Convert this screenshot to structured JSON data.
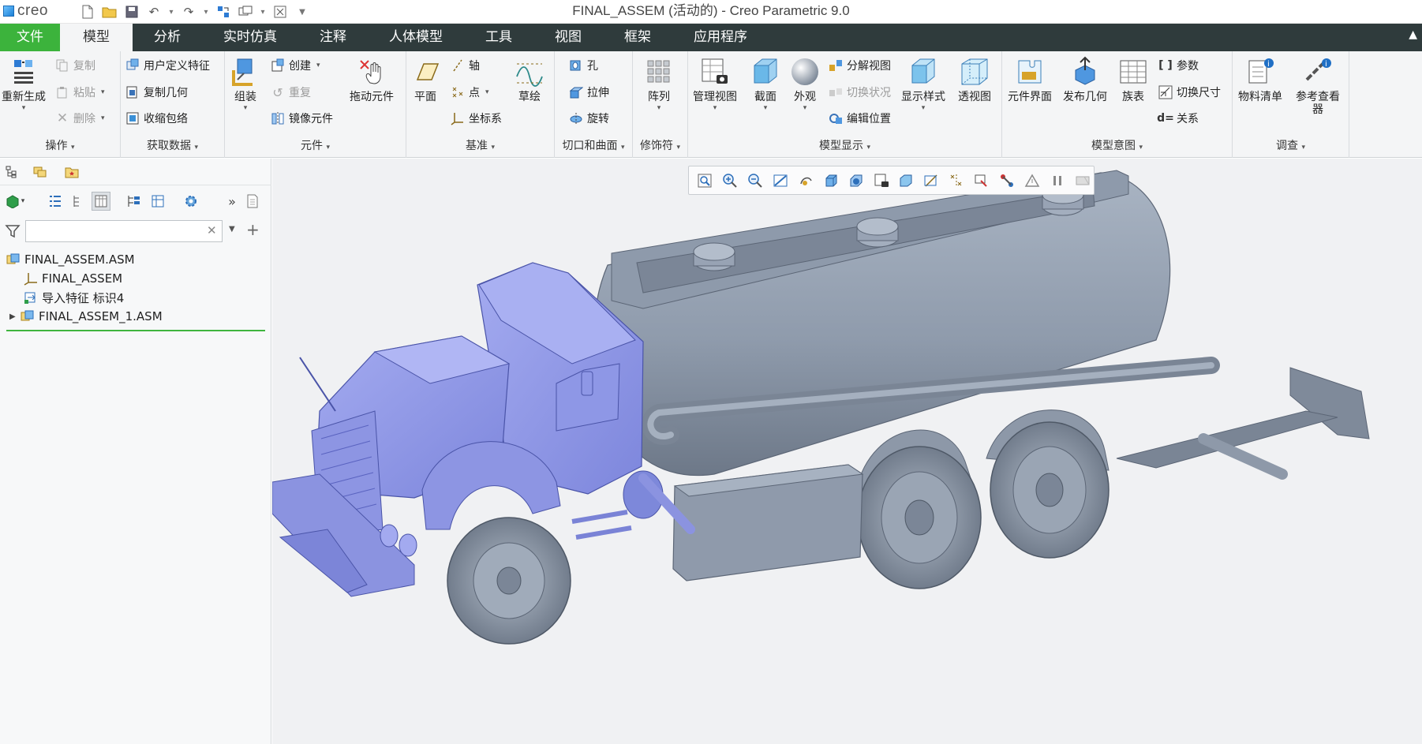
{
  "app": {
    "logo_text": "creo",
    "window_title": "FINAL_ASSEM (活动的) - Creo Parametric 9.0"
  },
  "tabs": [
    {
      "label": "文件"
    },
    {
      "label": "模型"
    },
    {
      "label": "分析"
    },
    {
      "label": "实时仿真"
    },
    {
      "label": "注释"
    },
    {
      "label": "人体模型"
    },
    {
      "label": "工具"
    },
    {
      "label": "视图"
    },
    {
      "label": "框架"
    },
    {
      "label": "应用程序"
    }
  ],
  "ribbon": {
    "operations": {
      "label": "操作",
      "regenerate": "重新生成",
      "copy": "复制",
      "paste": "粘贴",
      "delete": "删除"
    },
    "get_data": {
      "label": "获取数据",
      "udf": "用户定义特征",
      "copy_geom": "复制几何",
      "shrinkwrap": "收缩包络"
    },
    "components": {
      "label": "元件",
      "assemble": "组装",
      "create": "创建",
      "repeat": "重复",
      "mirror": "镜像元件",
      "drag": "拖动元件"
    },
    "datum": {
      "label": "基准",
      "plane": "平面",
      "axis": "轴",
      "point": "点",
      "csys": "坐标系",
      "sketch": "草绘"
    },
    "cut_surface": {
      "label": "切口和曲面",
      "hole": "孔",
      "extrude": "拉伸",
      "revolve": "旋转"
    },
    "modifiers": {
      "label": "修饰符",
      "pattern": "阵列"
    },
    "model_display": {
      "label": "模型显示",
      "manage_views": "管理视图",
      "section": "截面",
      "appearance": "外观",
      "explode": "分解视图",
      "toggle_status": "切换状况",
      "edit_position": "编辑位置",
      "display_style": "显示样式",
      "perspective": "透视图"
    },
    "model_intent": {
      "label": "模型意图",
      "component_interface": "元件界面",
      "publish_geom": "发布几何",
      "family_table": "族表",
      "parameters": "参数",
      "switch_dims": "切换尺寸",
      "relations": "关系"
    },
    "investigate": {
      "label": "调查",
      "bom": "物料清单",
      "ref_viewer": "参考查看器"
    }
  },
  "tree": {
    "search_value": "",
    "items": [
      {
        "label": "FINAL_ASSEM.ASM"
      },
      {
        "label": "FINAL_ASSEM"
      },
      {
        "label": "导入特征 标识4"
      },
      {
        "label": "FINAL_ASSEM_1.ASM"
      }
    ]
  },
  "colors": {
    "file_tab": "#3cb33c",
    "tab_bar": "#2f3b3c",
    "cab_highlight": "#8f98e6",
    "body_gray": "#8e9bab"
  }
}
